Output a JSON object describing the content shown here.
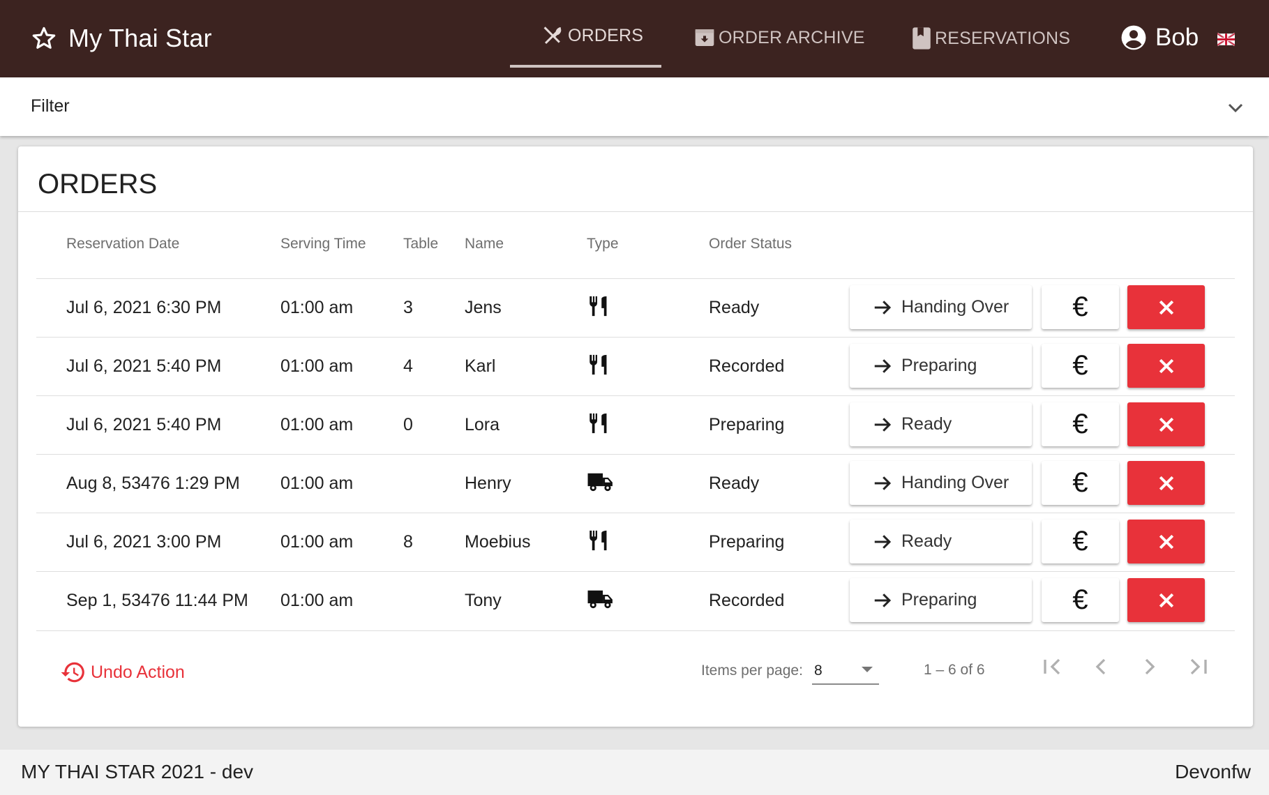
{
  "header": {
    "app_title": "My Thai Star",
    "nav": [
      {
        "label": "ORDERS",
        "icon": "utensils-crossed-icon",
        "active": true
      },
      {
        "label": "ORDER ARCHIVE",
        "icon": "archive-icon"
      },
      {
        "label": "RESERVATIONS",
        "icon": "bookmark-book-icon"
      }
    ],
    "user_name": "Bob",
    "language_flag": "uk-flag-icon"
  },
  "filter": {
    "label": "Filter"
  },
  "orders": {
    "title": "ORDERS",
    "columns": [
      "Reservation Date",
      "Serving Time",
      "Table",
      "Name",
      "Type",
      "Order Status"
    ],
    "rows": [
      {
        "date": "Jul 6, 2021 6:30 PM",
        "serving": "01:00 am",
        "table": "3",
        "name": "Jens",
        "type": "dine-in",
        "status": "Ready",
        "next": "Handing Over"
      },
      {
        "date": "Jul 6, 2021 5:40 PM",
        "serving": "01:00 am",
        "table": "4",
        "name": "Karl",
        "type": "dine-in",
        "status": "Recorded",
        "next": "Preparing"
      },
      {
        "date": "Jul 6, 2021 5:40 PM",
        "serving": "01:00 am",
        "table": "0",
        "name": "Lora",
        "type": "dine-in",
        "status": "Preparing",
        "next": "Ready"
      },
      {
        "date": "Aug 8, 53476 1:29 PM",
        "serving": "01:00 am",
        "table": "",
        "name": "Henry",
        "type": "delivery",
        "status": "Ready",
        "next": "Handing Over"
      },
      {
        "date": "Jul 6, 2021 3:00 PM",
        "serving": "01:00 am",
        "table": "8",
        "name": "Moebius",
        "type": "dine-in",
        "status": "Preparing",
        "next": "Ready"
      },
      {
        "date": "Sep 1, 53476 11:44 PM",
        "serving": "01:00 am",
        "table": "",
        "name": "Tony",
        "type": "delivery",
        "status": "Recorded",
        "next": "Preparing"
      }
    ],
    "euro_symbol": "€",
    "undo_label": "Undo Action",
    "items_per_page_label": "Items per page:",
    "items_per_page_value": "8",
    "range_label": "1 – 6 of 6"
  },
  "footer": {
    "left": "MY THAI STAR 2021 - dev",
    "right": "Devonfw"
  },
  "colors": {
    "header_bg": "#3c2320",
    "danger": "#e8323a"
  }
}
